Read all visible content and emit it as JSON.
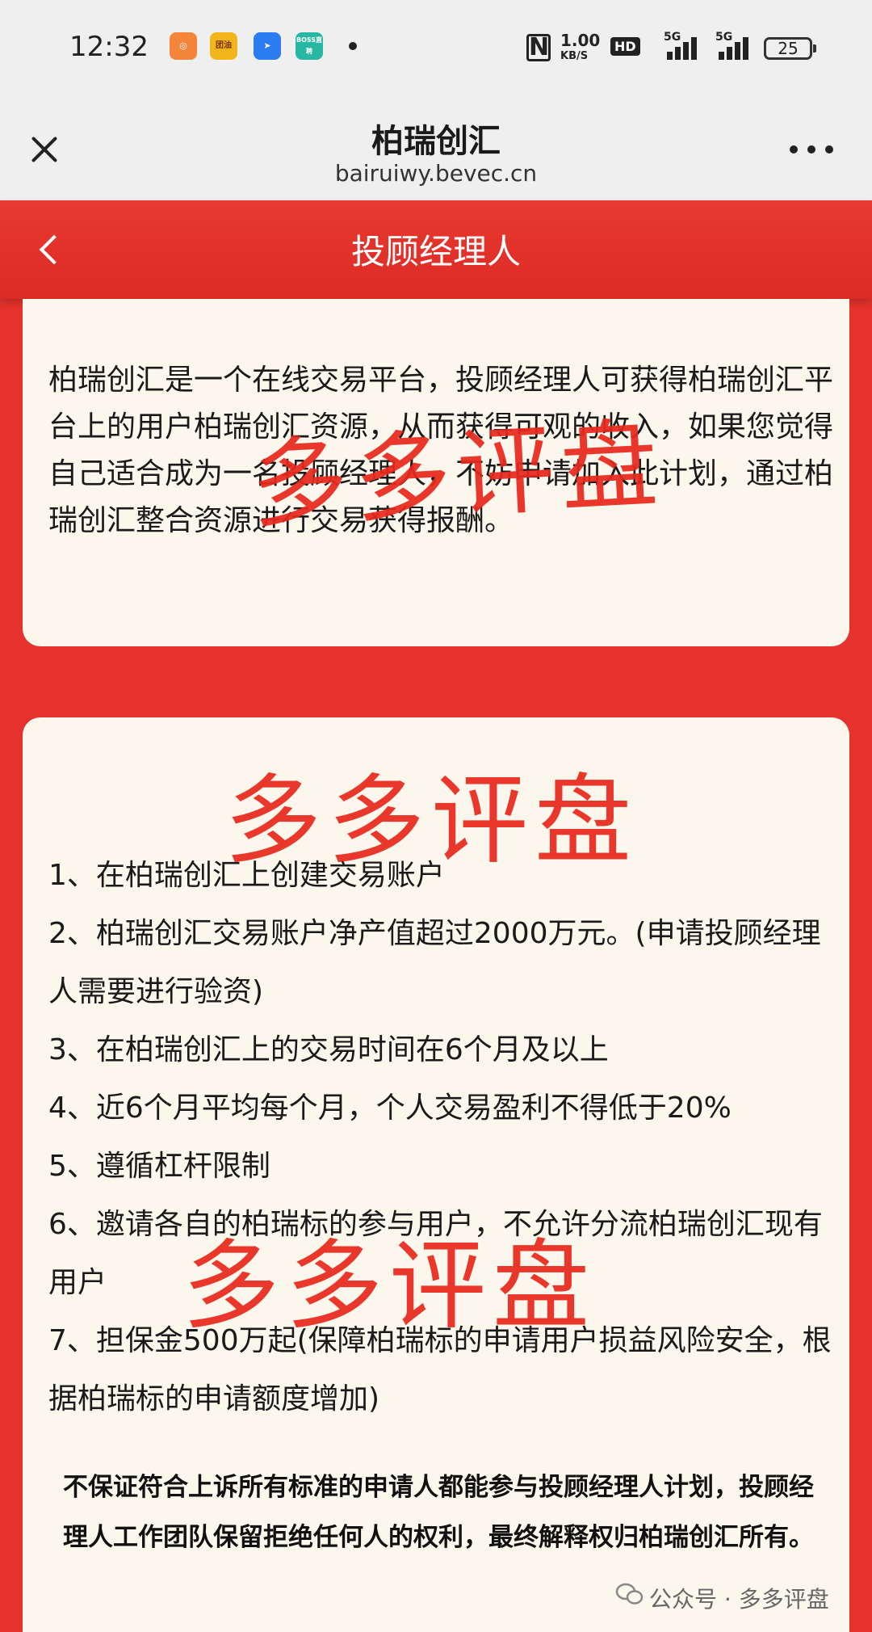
{
  "status_bar": {
    "time": "12:32",
    "apps": [
      {
        "icon": "meituan-icon",
        "label": "",
        "color": "#f5853a"
      },
      {
        "icon": "tuanyou-icon",
        "label": "团油",
        "color": "#f2b51c"
      },
      {
        "icon": "dingtalk-icon",
        "label": "",
        "color": "#2a7cf0"
      },
      {
        "icon": "boss-zhipin-icon",
        "label": "BOSS直聘",
        "color": "#27b7a3"
      }
    ],
    "nfc": "N",
    "speed_value": "1.00",
    "speed_unit": "KB/S",
    "hd_badge": "HD",
    "signal_1": "5G",
    "signal_2": "5G",
    "battery": "25"
  },
  "browser": {
    "title": "柏瑞创汇",
    "url": "bairuiwy.bevec.cn"
  },
  "page_header": {
    "title": "投顾经理人"
  },
  "intro": {
    "text": "柏瑞创汇是一个在线交易平台，投顾经理人可获得柏瑞创汇平台上的用户柏瑞创汇资源，从而获得可观的收入，如果您觉得自己适合成为一名投顾经理人，不妨申请加入此计划，通过柏瑞创汇整合资源进行交易获得报酬。"
  },
  "requirements": [
    "1、在柏瑞创汇上创建交易账户",
    "2、柏瑞创汇交易账户净产值超过2000万元。(申请投顾经理人需要进行验资)",
    "3、在柏瑞创汇上的交易时间在6个月及以上",
    "4、近6个月平均每个月，个人交易盈利不得低于20%",
    "5、遵循杠杆限制",
    "6、邀请各自的柏瑞标的参与用户，不允许分流柏瑞创汇现有用户",
    "7、担保金500万起(保障柏瑞标的申请用户损益风险安全，根据柏瑞标的申请额度增加)"
  ],
  "disclaimer": "不保证符合上诉所有标准的申请人都能参与投顾经理人计划，投顾经理人工作团队保留拒绝任何人的权利，最终解释权归柏瑞创汇所有。",
  "watermark": "多多评盘",
  "source": {
    "label": "公众号 · 多多评盘"
  },
  "colors": {
    "header_red": "#e5322c",
    "card_bg": "#fcf7ec",
    "watermark_red": "#e8291e"
  }
}
